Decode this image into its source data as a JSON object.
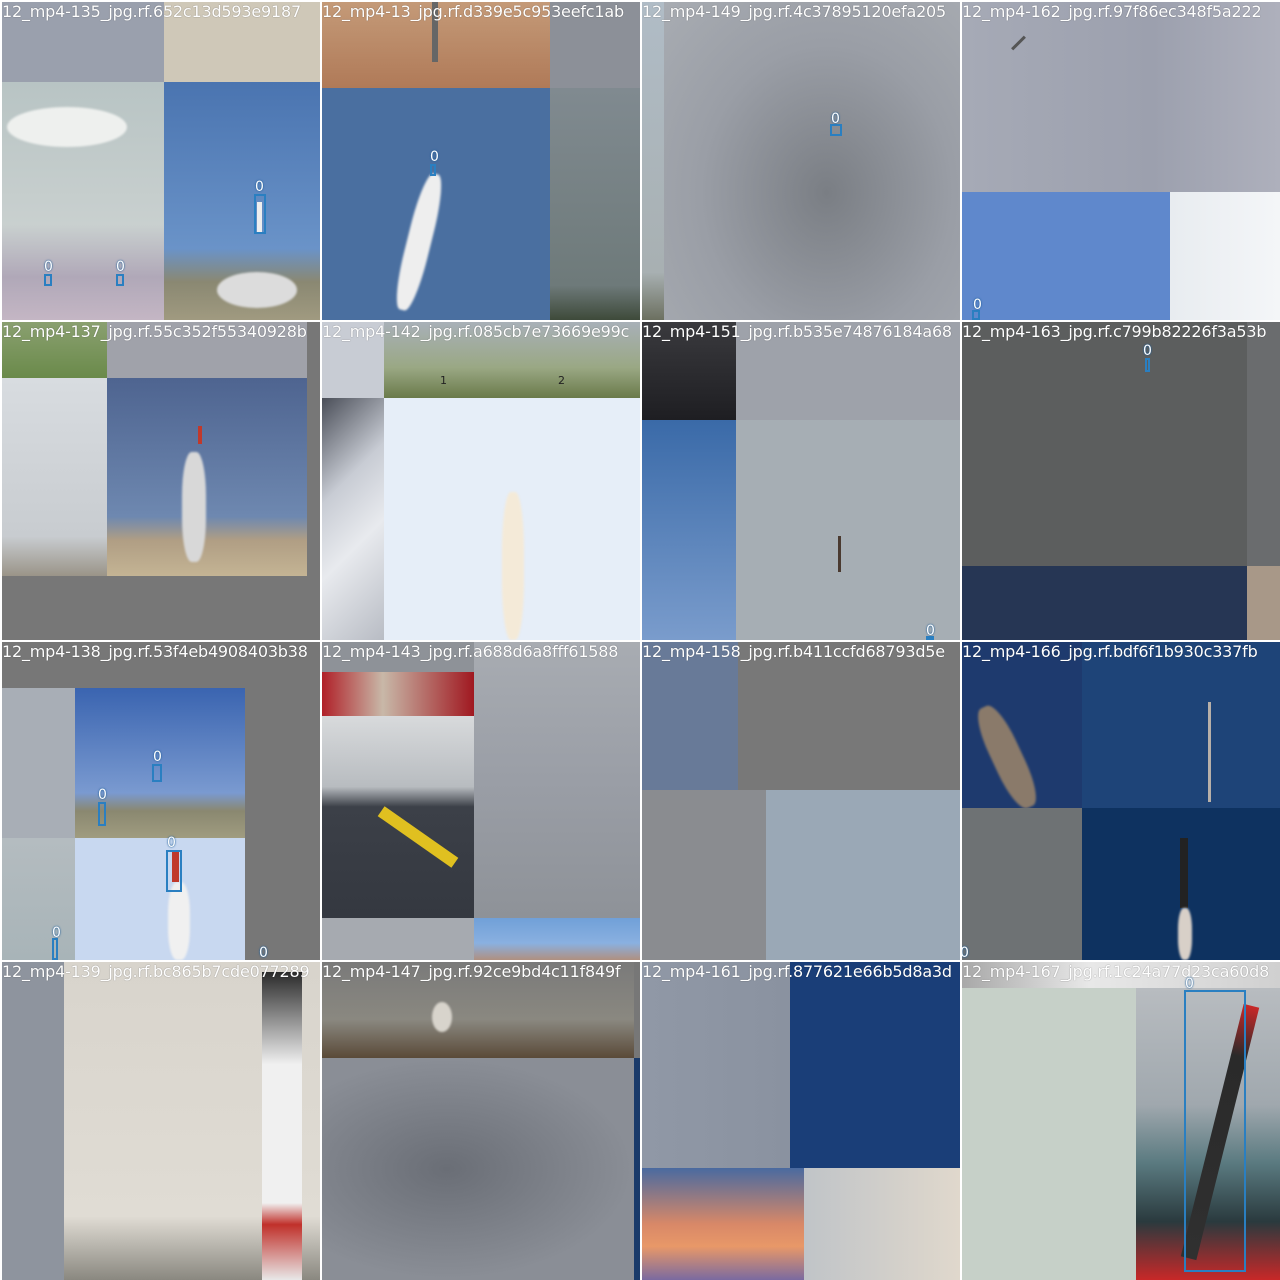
{
  "colors": {
    "bbox": "#2a7fc1",
    "label_text": "#ffffff",
    "mosaic_gray": "#777777"
  },
  "tiles": [
    {
      "title": "12_mp4-135_jpg.rf.652c13d593e9187",
      "boxes": [
        "0",
        "0",
        "0"
      ]
    },
    {
      "title": "12_mp4-13_jpg.rf.d339e5c953eefc1ab",
      "boxes": [
        "0"
      ]
    },
    {
      "title": "12_mp4-149_jpg.rf.4c37895120efa205",
      "boxes": [
        "0"
      ]
    },
    {
      "title": "12_mp4-162_jpg.rf.97f86ec348f5a222",
      "boxes": [
        "0"
      ]
    },
    {
      "title": "12_mp4-137_jpg.rf.55c352f55340928b",
      "boxes": []
    },
    {
      "title": "12_mp4-142_jpg.rf.085cb7e73669e99c",
      "boxes": []
    },
    {
      "title": "12_mp4-151_jpg.rf.b535e74876184a68",
      "boxes": [
        "0"
      ]
    },
    {
      "title": "12_mp4-163_jpg.rf.c799b82226f3a53b",
      "boxes": [
        "0"
      ]
    },
    {
      "title": "12_mp4-138_jpg.rf.53f4eb4908403b38",
      "boxes": [
        "0",
        "0",
        "0",
        "0",
        "0"
      ]
    },
    {
      "title": "12_mp4-143_jpg.rf.a688d6a8fff61588",
      "boxes": []
    },
    {
      "title": "12_mp4-158_jpg.rf.b411ccfd68793d5e",
      "boxes": []
    },
    {
      "title": "12_mp4-166_jpg.rf.bdf6f1b930c337fb",
      "boxes": [
        "0"
      ]
    },
    {
      "title": "12_mp4-139_jpg.rf.bc865b7cde077289",
      "boxes": []
    },
    {
      "title": "12_mp4-147_jpg.rf.92ce9bd4c11f849f",
      "boxes": []
    },
    {
      "title": "12_mp4-161_jpg.rf.877621e66b5d8a3d",
      "boxes": []
    },
    {
      "title": "12_mp4-167_jpg.rf.1c24a77d23ca60d8",
      "boxes": [
        "0"
      ]
    }
  ],
  "scene_marks": [
    "1",
    "2"
  ]
}
